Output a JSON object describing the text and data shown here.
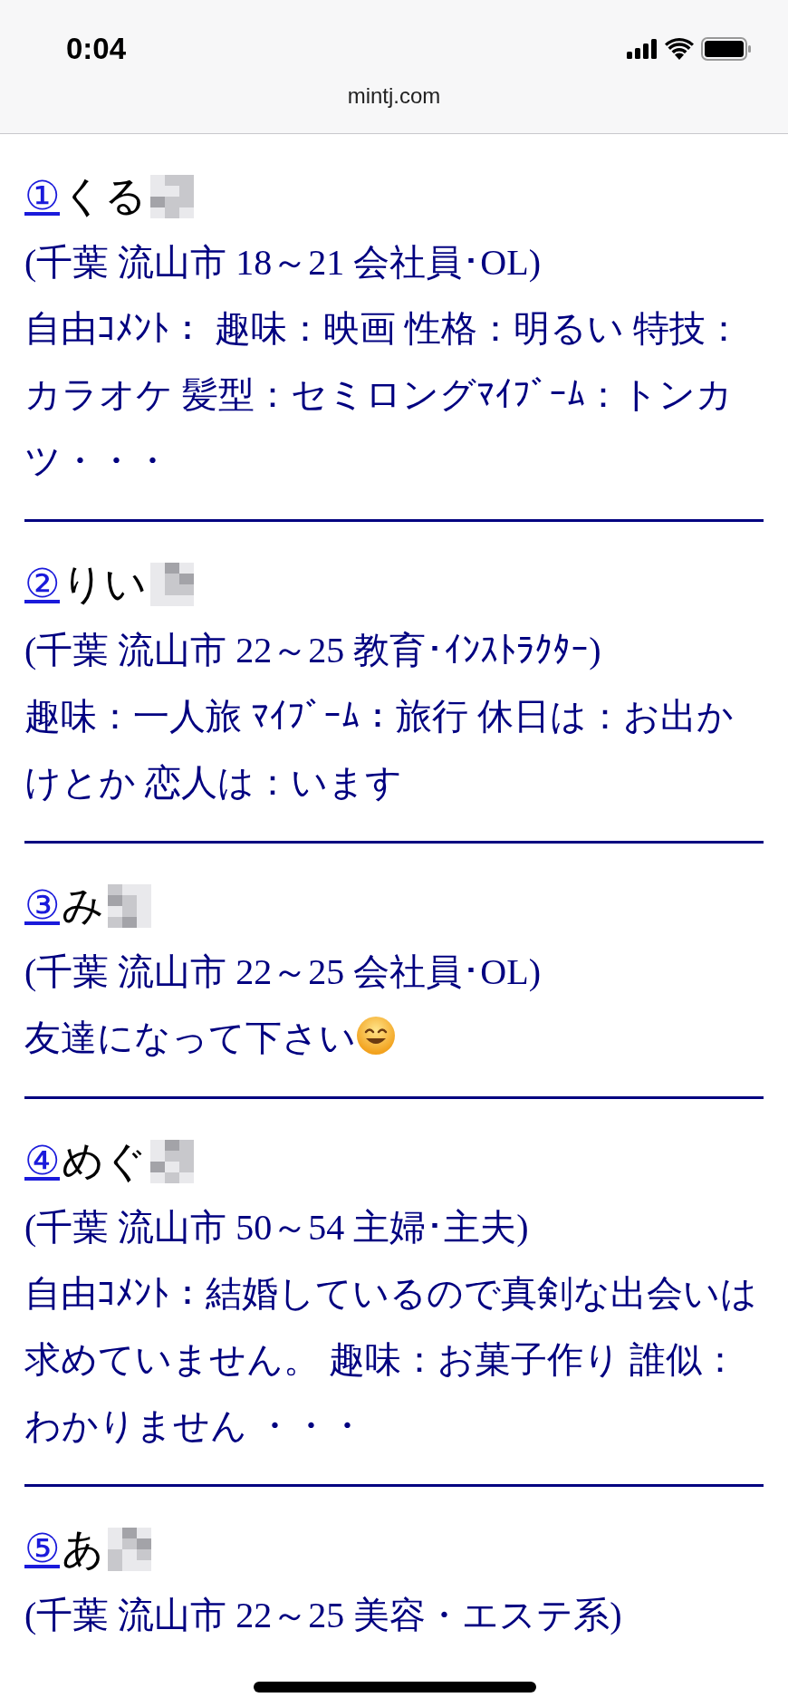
{
  "status_bar": {
    "time": "0:04"
  },
  "address_bar": {
    "url": "mintj.com"
  },
  "profiles": [
    {
      "number": "①",
      "name": "くる",
      "details": "(千葉 流山市 18～21 会社員･OL)",
      "comment": "自由ｺﾒﾝﾄ： 趣味：映画 性格：明るい 特技：カラオケ 髪型：セミロングﾏｲﾌﾞｰﾑ：トンカツ・・・"
    },
    {
      "number": "②",
      "name": "りい",
      "details": "(千葉 流山市 22～25 教育･ｲﾝｽﾄﾗｸﾀｰ)",
      "comment": "趣味：一人旅 ﾏｲﾌﾞｰﾑ：旅行 休日は：お出かけとか 恋人は：います"
    },
    {
      "number": "③",
      "name": "み",
      "details": "(千葉 流山市 22～25 会社員･OL)",
      "comment": "友達になって下さい",
      "smiley": true
    },
    {
      "number": "④",
      "name": "めぐ",
      "details": "(千葉 流山市 50～54 主婦･主夫)",
      "comment": "自由ｺﾒﾝﾄ：結婚しているので真剣な出会いは求めていません。 趣味：お菓子作り 誰似：わかりません ・・・"
    },
    {
      "number": "⑤",
      "name": "あ",
      "details": "(千葉 流山市 22～25 美容・エステ系)"
    }
  ]
}
